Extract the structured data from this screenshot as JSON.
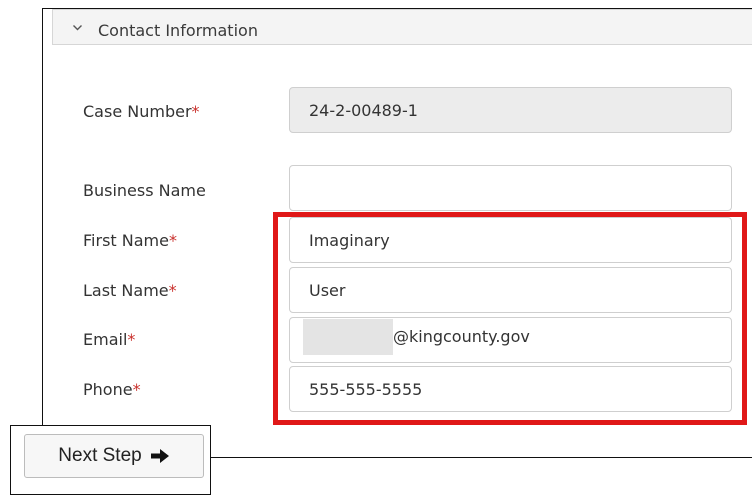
{
  "section": {
    "title": "Contact Information",
    "icon": "chevron-down-icon"
  },
  "form": {
    "required_marker": "*",
    "case_number": {
      "label": "Case Number",
      "value": "24-2-00489-1"
    },
    "business_name": {
      "label": "Business Name",
      "value": ""
    },
    "first_name": {
      "label": "First Name",
      "value": "Imaginary"
    },
    "last_name": {
      "label": "Last Name",
      "value": "User"
    },
    "email": {
      "label": "Email",
      "value_visible": "@kingcounty.gov"
    },
    "phone": {
      "label": "Phone",
      "value": "555-555-5555"
    }
  },
  "actions": {
    "next_label": "Next Step",
    "next_icon": "arrow-right-icon"
  },
  "colors": {
    "highlight": "#e01818",
    "required": "#c9302c"
  }
}
